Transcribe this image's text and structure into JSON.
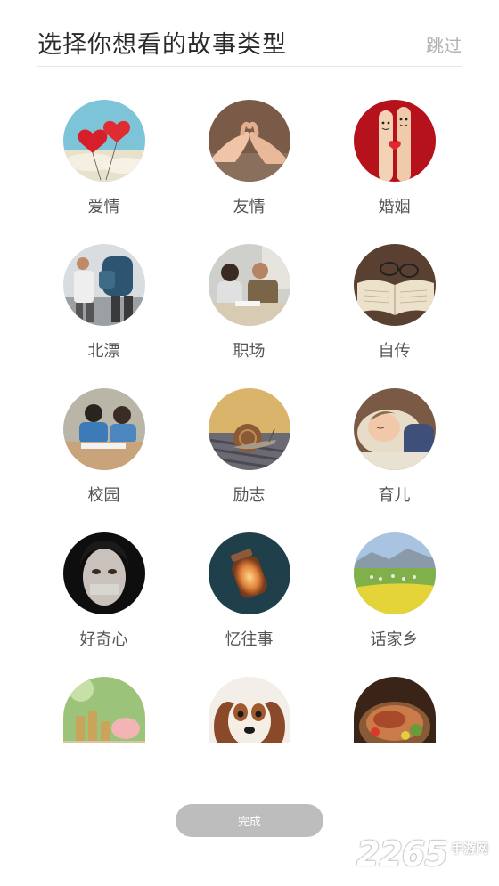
{
  "header": {
    "title": "选择你想看的故事类型",
    "skip_label": "跳过"
  },
  "categories": [
    {
      "label": "爱情",
      "icon": "heart-balloons-image"
    },
    {
      "label": "友情",
      "icon": "pinky-promise-image"
    },
    {
      "label": "婚姻",
      "icon": "finger-couple-image"
    },
    {
      "label": "北漂",
      "icon": "travelers-backpack-image"
    },
    {
      "label": "职场",
      "icon": "office-meeting-image"
    },
    {
      "label": "自传",
      "icon": "open-book-glasses-image"
    },
    {
      "label": "校园",
      "icon": "students-classroom-image"
    },
    {
      "label": "励志",
      "icon": "snail-image"
    },
    {
      "label": "育儿",
      "icon": "sleeping-child-image"
    },
    {
      "label": "好奇心",
      "icon": "taped-mouth-girl-image"
    },
    {
      "label": "忆往事",
      "icon": "glowing-jar-image"
    },
    {
      "label": "话家乡",
      "icon": "countryside-field-image"
    },
    {
      "label": "",
      "icon": "coins-piggy-bank-image"
    },
    {
      "label": "",
      "icon": "puppy-image"
    },
    {
      "label": "",
      "icon": "food-platter-image"
    }
  ],
  "footer": {
    "done_label": "完成"
  },
  "watermark": {
    "number": "2265",
    "text": "手游网"
  }
}
